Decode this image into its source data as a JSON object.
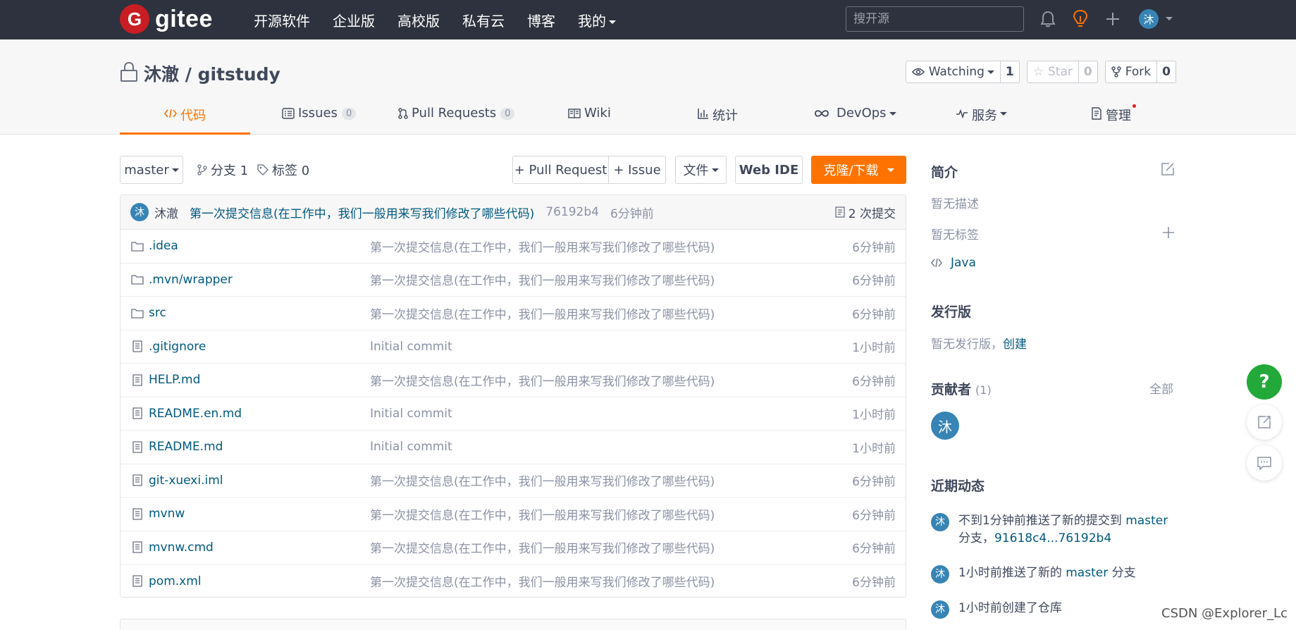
{
  "nav": {
    "logo_letter": "G",
    "logo_text": "gitee",
    "items": [
      "开源软件",
      "企业版",
      "高校版",
      "私有云",
      "博客",
      "我的"
    ],
    "search_placeholder": "搜开源",
    "avatar_char": "沐"
  },
  "repo": {
    "owner": "沐澈",
    "separator": " / ",
    "name": "gitstudy",
    "watch_label": "Watching",
    "watch_count": "1",
    "star_label": "Star",
    "star_count": "0",
    "fork_label": "Fork",
    "fork_count": "0"
  },
  "tabs": [
    {
      "label": "代码",
      "badge": ""
    },
    {
      "label": "Issues",
      "badge": "0"
    },
    {
      "label": "Pull Requests",
      "badge": "0"
    },
    {
      "label": "Wiki",
      "badge": ""
    },
    {
      "label": "统计",
      "badge": ""
    },
    {
      "label": "DevOps",
      "badge": ""
    },
    {
      "label": "服务",
      "badge": ""
    },
    {
      "label": "管理",
      "badge": ""
    }
  ],
  "toolbar": {
    "branch": "master",
    "branches": "分支 1",
    "tags": "标签 0",
    "pull_request": "+ Pull Request",
    "issue": "+ Issue",
    "file": "文件",
    "web_ide": "Web IDE",
    "clone": "克隆/下载"
  },
  "commit": {
    "avatar_char": "沐",
    "author": "沐澈",
    "message": "第一次提交信息(在工作中，我们一般用来写我们修改了哪些代码)",
    "sha": "76192b4",
    "time": "6分钟前",
    "count": "2 次提交"
  },
  "files": [
    {
      "type": "folder",
      "name": ".idea",
      "message": "第一次提交信息(在工作中，我们一般用来写我们修改了哪些代码)",
      "time": "6分钟前"
    },
    {
      "type": "folder",
      "name": ".mvn/wrapper",
      "message": "第一次提交信息(在工作中，我们一般用来写我们修改了哪些代码)",
      "time": "6分钟前"
    },
    {
      "type": "folder",
      "name": "src",
      "message": "第一次提交信息(在工作中，我们一般用来写我们修改了哪些代码)",
      "time": "6分钟前"
    },
    {
      "type": "file",
      "name": ".gitignore",
      "message": "Initial commit",
      "time": "1小时前"
    },
    {
      "type": "file",
      "name": "HELP.md",
      "message": "第一次提交信息(在工作中，我们一般用来写我们修改了哪些代码)",
      "time": "6分钟前"
    },
    {
      "type": "file",
      "name": "README.en.md",
      "message": "Initial commit",
      "time": "1小时前"
    },
    {
      "type": "file",
      "name": "README.md",
      "message": "Initial commit",
      "time": "1小时前"
    },
    {
      "type": "file",
      "name": "git-xuexi.iml",
      "message": "第一次提交信息(在工作中，我们一般用来写我们修改了哪些代码)",
      "time": "6分钟前"
    },
    {
      "type": "file",
      "name": "mvnw",
      "message": "第一次提交信息(在工作中，我们一般用来写我们修改了哪些代码)",
      "time": "6分钟前"
    },
    {
      "type": "file",
      "name": "mvnw.cmd",
      "message": "第一次提交信息(在工作中，我们一般用来写我们修改了哪些代码)",
      "time": "6分钟前"
    },
    {
      "type": "file",
      "name": "pom.xml",
      "message": "第一次提交信息(在工作中，我们一般用来写我们修改了哪些代码)",
      "time": "6分钟前"
    }
  ],
  "sidebar": {
    "intro_title": "简介",
    "no_desc": "暂无描述",
    "no_tags": "暂无标签",
    "language": "Java",
    "release_title": "发行版",
    "no_release": "暂无发行版，",
    "create": "创建",
    "contributors_title": "贡献者",
    "contributors_count": "(1)",
    "all": "全部",
    "contributor_avatar": "沐",
    "activity_title": "近期动态",
    "activities": [
      {
        "avatar": "沐",
        "pre": "不到1分钟前推送了新的提交到 ",
        "link": "master",
        "post": " 分支，",
        "link2": "91618c4...76192b4"
      },
      {
        "avatar": "沐",
        "pre": "1小时前推送了新的 ",
        "link": "master",
        "post": " 分支",
        "link2": ""
      },
      {
        "avatar": "沐",
        "pre": "1小时前创建了仓库",
        "link": "",
        "post": "",
        "link2": ""
      }
    ]
  },
  "floating": {
    "help": "?"
  },
  "watermark": "CSDN @Explorer_Lc",
  "colors": {
    "accent": "#fe7300",
    "nav_bg": "#2e323e",
    "link": "#005980",
    "help": "#23a93a"
  }
}
